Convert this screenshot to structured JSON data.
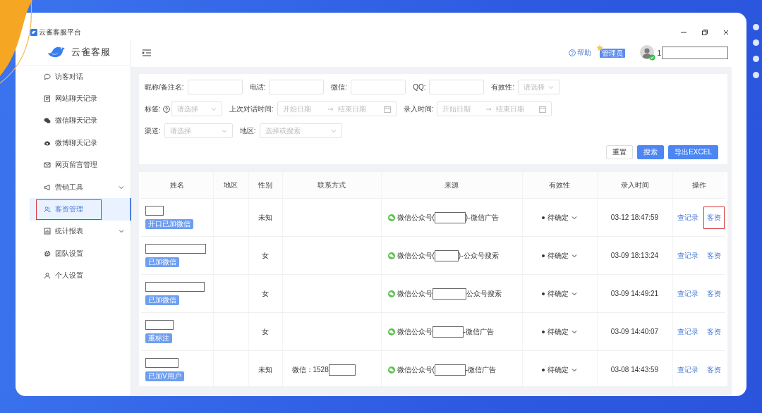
{
  "window": {
    "title": "云雀客服平台"
  },
  "sidebar": {
    "logo": "云雀客服",
    "items": [
      {
        "label": "访客对话",
        "selected": false,
        "expandable": false,
        "highlighted": false
      },
      {
        "label": "网站聊天记录",
        "selected": false,
        "expandable": false,
        "highlighted": false
      },
      {
        "label": "微信聊天记录",
        "selected": false,
        "expandable": false,
        "highlighted": false
      },
      {
        "label": "微博聊天记录",
        "selected": false,
        "expandable": false,
        "highlighted": false
      },
      {
        "label": "网页留言管理",
        "selected": false,
        "expandable": false,
        "highlighted": false
      },
      {
        "label": "营销工具",
        "selected": false,
        "expandable": true,
        "highlighted": false
      },
      {
        "label": "客资管理",
        "selected": true,
        "expandable": false,
        "highlighted": true
      },
      {
        "label": "统计报表",
        "selected": false,
        "expandable": true,
        "highlighted": false
      },
      {
        "label": "团队设置",
        "selected": false,
        "expandable": false,
        "highlighted": false
      },
      {
        "label": "个人设置",
        "selected": false,
        "expandable": false,
        "highlighted": false
      }
    ]
  },
  "header": {
    "help": "帮助",
    "badge": "管理员",
    "user": {
      "text": "1",
      "redacted": true
    }
  },
  "filters": {
    "lines": [
      {
        "fields": [
          {
            "kind": "input",
            "label": "昵称/备注名:",
            "help": false
          },
          {
            "kind": "input",
            "label": "电话:",
            "help": false
          },
          {
            "kind": "input",
            "label": "微信:",
            "help": false
          },
          {
            "kind": "input",
            "label": "QQ:",
            "help": false
          },
          {
            "kind": "select",
            "label": "有效性:",
            "help": false,
            "placeholder": "请选择"
          }
        ]
      },
      {
        "fields": [
          {
            "kind": "select",
            "label": "标签:",
            "help": true,
            "placeholder": "请选择"
          },
          {
            "kind": "daterange",
            "label": "上次对话时间:",
            "help": false,
            "start_placeholder": "开始日期",
            "end_placeholder": "结束日期"
          },
          {
            "kind": "daterange",
            "label": "录入时间:",
            "help": false,
            "start_placeholder": "开始日期",
            "end_placeholder": "结束日期"
          }
        ]
      },
      {
        "fields": [
          {
            "kind": "select",
            "label": "渠道:",
            "help": false,
            "placeholder": "请选择"
          },
          {
            "kind": "select",
            "label": "地区:",
            "help": false,
            "placeholder": "选择或搜索"
          }
        ]
      }
    ],
    "buttons": [
      {
        "label": "重置",
        "kind": "default"
      },
      {
        "label": "搜索",
        "kind": "primary"
      },
      {
        "label": "导出EXCEL",
        "kind": "primary"
      }
    ]
  },
  "table": {
    "columns": [
      "姓名",
      "地区",
      "性别",
      "联系方式",
      "来源",
      "有效性",
      "录入时间",
      "操作"
    ],
    "rows": [
      {
        "name_redacted": true,
        "tag": "开口已加微信",
        "gender": "未知",
        "source": {
          "prefix": "微信公众号(",
          "redacted": true,
          "suffix": ")-微信广告"
        },
        "validity": "待确定",
        "time": "03-12 18:47:59",
        "actions": [
          {
            "label": "查记录",
            "highlighted": false
          },
          {
            "label": "客资",
            "highlighted": true
          }
        ]
      },
      {
        "name_redacted": true,
        "tag": "已加微信",
        "gender": "女",
        "source": {
          "prefix": "微信公众号(",
          "redacted": true,
          "suffix": ")-公众号搜索"
        },
        "validity": "待确定",
        "time": "03-09 18:13:24",
        "actions": [
          {
            "label": "查记录",
            "highlighted": false
          },
          {
            "label": "客资",
            "highlighted": false
          }
        ]
      },
      {
        "name_redacted": true,
        "tag": "已加微信",
        "gender": "女",
        "source": {
          "prefix": "微信公众号",
          "redacted": true,
          "suffix": "公众号搜索"
        },
        "validity": "待确定",
        "time": "03-09 14:49:21",
        "actions": [
          {
            "label": "查记录",
            "highlighted": false
          },
          {
            "label": "客资",
            "highlighted": false
          }
        ]
      },
      {
        "name_redacted": true,
        "tag": "重标注",
        "gender": "女",
        "source": {
          "prefix": "微信公众号",
          "redacted": true,
          "suffix": "-微信广告"
        },
        "validity": "待确定",
        "time": "03-09 14:40:07",
        "actions": [
          {
            "label": "查记录",
            "highlighted": false
          },
          {
            "label": "客资",
            "highlighted": false
          }
        ]
      },
      {
        "name_redacted": true,
        "tag": "已加V用户",
        "gender": "未知",
        "contact": {
          "text": "微信：1528",
          "redacted": true
        },
        "source": {
          "prefix": "微信公众号(",
          "redacted": true,
          "suffix": "-微信广告"
        },
        "validity": "待确定",
        "time": "03-08 14:43:59",
        "actions": [
          {
            "label": "查记录",
            "highlighted": false
          },
          {
            "label": "客资",
            "highlighted": false
          }
        ]
      }
    ]
  }
}
